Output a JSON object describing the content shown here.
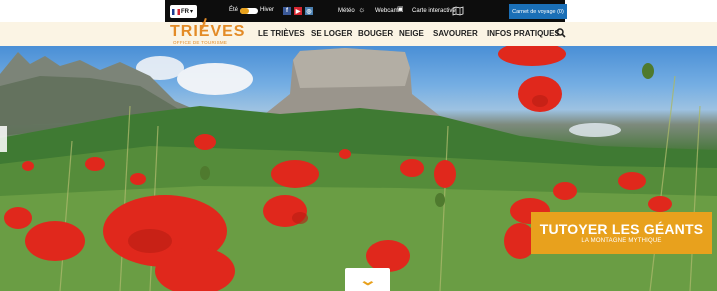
{
  "topbar": {
    "language": {
      "code": "FR",
      "flag": "fr-flag-icon",
      "caret": "chevron-down-icon"
    },
    "season": {
      "summer_label": "Été",
      "winter_label": "Hiver",
      "active": "summer"
    },
    "social": {
      "facebook": "f",
      "youtube": "▶",
      "instagram": "◎"
    },
    "weather_label": "Météo",
    "webcam_label": "Webcam",
    "map_label": "Carte interactive",
    "travel_book_label": "Carnet de voyage (0)"
  },
  "logo": {
    "name": "TRIÈVES",
    "tagline": "OFFICE DE TOURISME"
  },
  "nav": {
    "items": [
      {
        "label": "LE TRIÈVES"
      },
      {
        "label": "SE LOGER"
      },
      {
        "label": "BOUGER"
      },
      {
        "label": "NEIGE"
      },
      {
        "label": "SAVOURER"
      },
      {
        "label": "INFOS PRATIQUES"
      }
    ],
    "search_icon": "search-icon"
  },
  "hero": {
    "headline": "TUTOYER LES GÉANTS",
    "subheadline": "LA MONTAGNE MYTHIQUE",
    "scroll_icon": "chevron-down-icon"
  },
  "colors": {
    "accent": "#e8a11d",
    "brand_orange": "#e38b27",
    "nav_background": "#fbf4e4",
    "topbar_background": "#0d0d0d",
    "travel_book_blue": "#1a6fb7"
  }
}
